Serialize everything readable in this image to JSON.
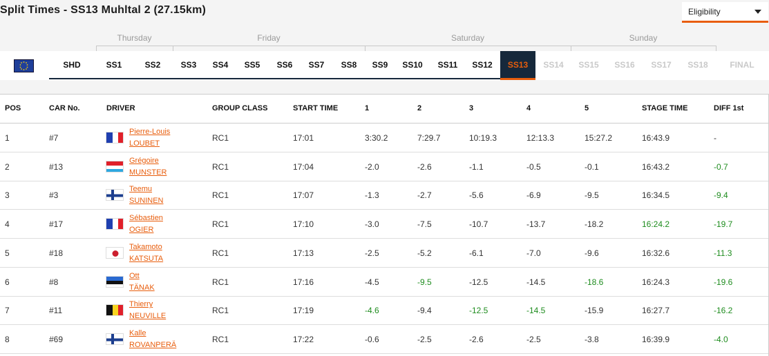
{
  "title": "Split Times - SS13 Muhltal 2 (27.15km)",
  "eligibility": {
    "label": "Eligibility",
    "icon": "chevron-down-icon"
  },
  "days": [
    "Thursday",
    "Friday",
    "Saturday",
    "Sunday"
  ],
  "stages": [
    {
      "label": "SHD",
      "state": "normal"
    },
    {
      "label": "SS1",
      "state": "normal"
    },
    {
      "label": "SS2",
      "state": "normal"
    },
    {
      "label": "SS3",
      "state": "normal"
    },
    {
      "label": "SS4",
      "state": "normal"
    },
    {
      "label": "SS5",
      "state": "normal"
    },
    {
      "label": "SS6",
      "state": "normal"
    },
    {
      "label": "SS7",
      "state": "normal"
    },
    {
      "label": "SS8",
      "state": "normal"
    },
    {
      "label": "SS9",
      "state": "normal"
    },
    {
      "label": "SS10",
      "state": "normal"
    },
    {
      "label": "SS11",
      "state": "normal"
    },
    {
      "label": "SS12",
      "state": "normal"
    },
    {
      "label": "SS13",
      "state": "active"
    },
    {
      "label": "SS14",
      "state": "disabled"
    },
    {
      "label": "SS15",
      "state": "disabled"
    },
    {
      "label": "SS16",
      "state": "disabled"
    },
    {
      "label": "SS17",
      "state": "disabled"
    },
    {
      "label": "SS18",
      "state": "disabled"
    },
    {
      "label": "FINAL",
      "state": "disabled"
    }
  ],
  "columns": [
    "POS",
    "CAR No.",
    "DRIVER",
    "GROUP CLASS",
    "START TIME",
    "1",
    "2",
    "3",
    "4",
    "5",
    "STAGE TIME",
    "DIFF 1st"
  ],
  "colors": {
    "accent": "#e85d0c",
    "navy": "#16283b",
    "green": "#1e8c1e"
  },
  "rows": [
    {
      "pos": "1",
      "car": "#7",
      "first": "Pierre-Louis",
      "last": "LOUBET",
      "flag": "FR",
      "group": "RC1",
      "start": "17:01",
      "s1": "3:30.2",
      "s2": "7:29.7",
      "s3": "10:19.3",
      "s4": "12:13.3",
      "s5": "15:27.2",
      "stage": "16:43.9",
      "diff": "-",
      "green": []
    },
    {
      "pos": "2",
      "car": "#13",
      "first": "Grégoire",
      "last": "MUNSTER",
      "flag": "LU",
      "group": "RC1",
      "start": "17:04",
      "s1": "-2.0",
      "s2": "-2.6",
      "s3": "-1.1",
      "s4": "-0.5",
      "s5": "-0.1",
      "stage": "16:43.2",
      "diff": "-0.7",
      "green": [
        "diff"
      ]
    },
    {
      "pos": "3",
      "car": "#3",
      "first": "Teemu",
      "last": "SUNINEN",
      "flag": "FI",
      "group": "RC1",
      "start": "17:07",
      "s1": "-1.3",
      "s2": "-2.7",
      "s3": "-5.6",
      "s4": "-6.9",
      "s5": "-9.5",
      "stage": "16:34.5",
      "diff": "-9.4",
      "green": [
        "diff"
      ]
    },
    {
      "pos": "4",
      "car": "#17",
      "first": "Sébastien",
      "last": "OGIER",
      "flag": "FR",
      "group": "RC1",
      "start": "17:10",
      "s1": "-3.0",
      "s2": "-7.5",
      "s3": "-10.7",
      "s4": "-13.7",
      "s5": "-18.2",
      "stage": "16:24.2",
      "diff": "-19.7",
      "green": [
        "stage",
        "diff"
      ]
    },
    {
      "pos": "5",
      "car": "#18",
      "first": "Takamoto",
      "last": "KATSUTA",
      "flag": "JP",
      "group": "RC1",
      "start": "17:13",
      "s1": "-2.5",
      "s2": "-5.2",
      "s3": "-6.1",
      "s4": "-7.0",
      "s5": "-9.6",
      "stage": "16:32.6",
      "diff": "-11.3",
      "green": [
        "diff"
      ]
    },
    {
      "pos": "6",
      "car": "#8",
      "first": "Ott",
      "last": "TÄNAK",
      "flag": "EE",
      "group": "RC1",
      "start": "17:16",
      "s1": "-4.5",
      "s2": "-9.5",
      "s3": "-12.5",
      "s4": "-14.5",
      "s5": "-18.6",
      "stage": "16:24.3",
      "diff": "-19.6",
      "green": [
        "s2",
        "s5",
        "diff"
      ]
    },
    {
      "pos": "7",
      "car": "#11",
      "first": "Thierry",
      "last": "NEUVILLE",
      "flag": "BE",
      "group": "RC1",
      "start": "17:19",
      "s1": "-4.6",
      "s2": "-9.4",
      "s3": "-12.5",
      "s4": "-14.5",
      "s5": "-15.9",
      "stage": "16:27.7",
      "diff": "-16.2",
      "green": [
        "s1",
        "s3",
        "s4",
        "diff"
      ]
    },
    {
      "pos": "8",
      "car": "#69",
      "first": "Kalle",
      "last": "ROVANPERÄ",
      "flag": "FI",
      "group": "RC1",
      "start": "17:22",
      "s1": "-0.6",
      "s2": "-2.5",
      "s3": "-2.6",
      "s4": "-2.5",
      "s5": "-3.8",
      "stage": "16:39.9",
      "diff": "-4.0",
      "green": [
        "diff"
      ]
    }
  ]
}
